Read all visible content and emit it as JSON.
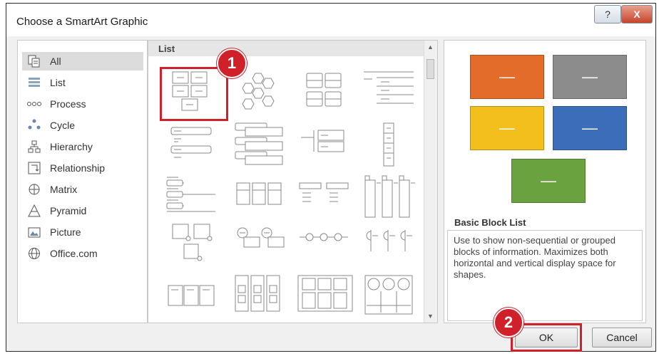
{
  "dialog": {
    "title": "Choose a SmartArt Graphic",
    "help_glyph": "?",
    "close_glyph": "X"
  },
  "categories": [
    {
      "label": "All",
      "icon": "all-icon",
      "selected": true
    },
    {
      "label": "List",
      "icon": "list-icon"
    },
    {
      "label": "Process",
      "icon": "process-icon"
    },
    {
      "label": "Cycle",
      "icon": "cycle-icon"
    },
    {
      "label": "Hierarchy",
      "icon": "hierarchy-icon"
    },
    {
      "label": "Relationship",
      "icon": "relationship-icon"
    },
    {
      "label": "Matrix",
      "icon": "matrix-icon"
    },
    {
      "label": "Pyramid",
      "icon": "pyramid-icon"
    },
    {
      "label": "Picture",
      "icon": "picture-icon"
    },
    {
      "label": "Office.com",
      "icon": "globe-icon"
    }
  ],
  "gallery": {
    "header": "List",
    "selected_index": 0
  },
  "annotations": {
    "badge1": "1",
    "badge2": "2"
  },
  "preview": {
    "block_glyph": "—",
    "colors": [
      "#e46c2a",
      "#8c8c8c",
      "#f2bf1c",
      "#3b6db8",
      "#6aa23f"
    ],
    "name": "Basic Block List",
    "description": "Use to show non-sequential or grouped blocks of information. Maximizes both horizontal and vertical display space for shapes."
  },
  "buttons": {
    "ok": "OK",
    "cancel": "Cancel"
  }
}
